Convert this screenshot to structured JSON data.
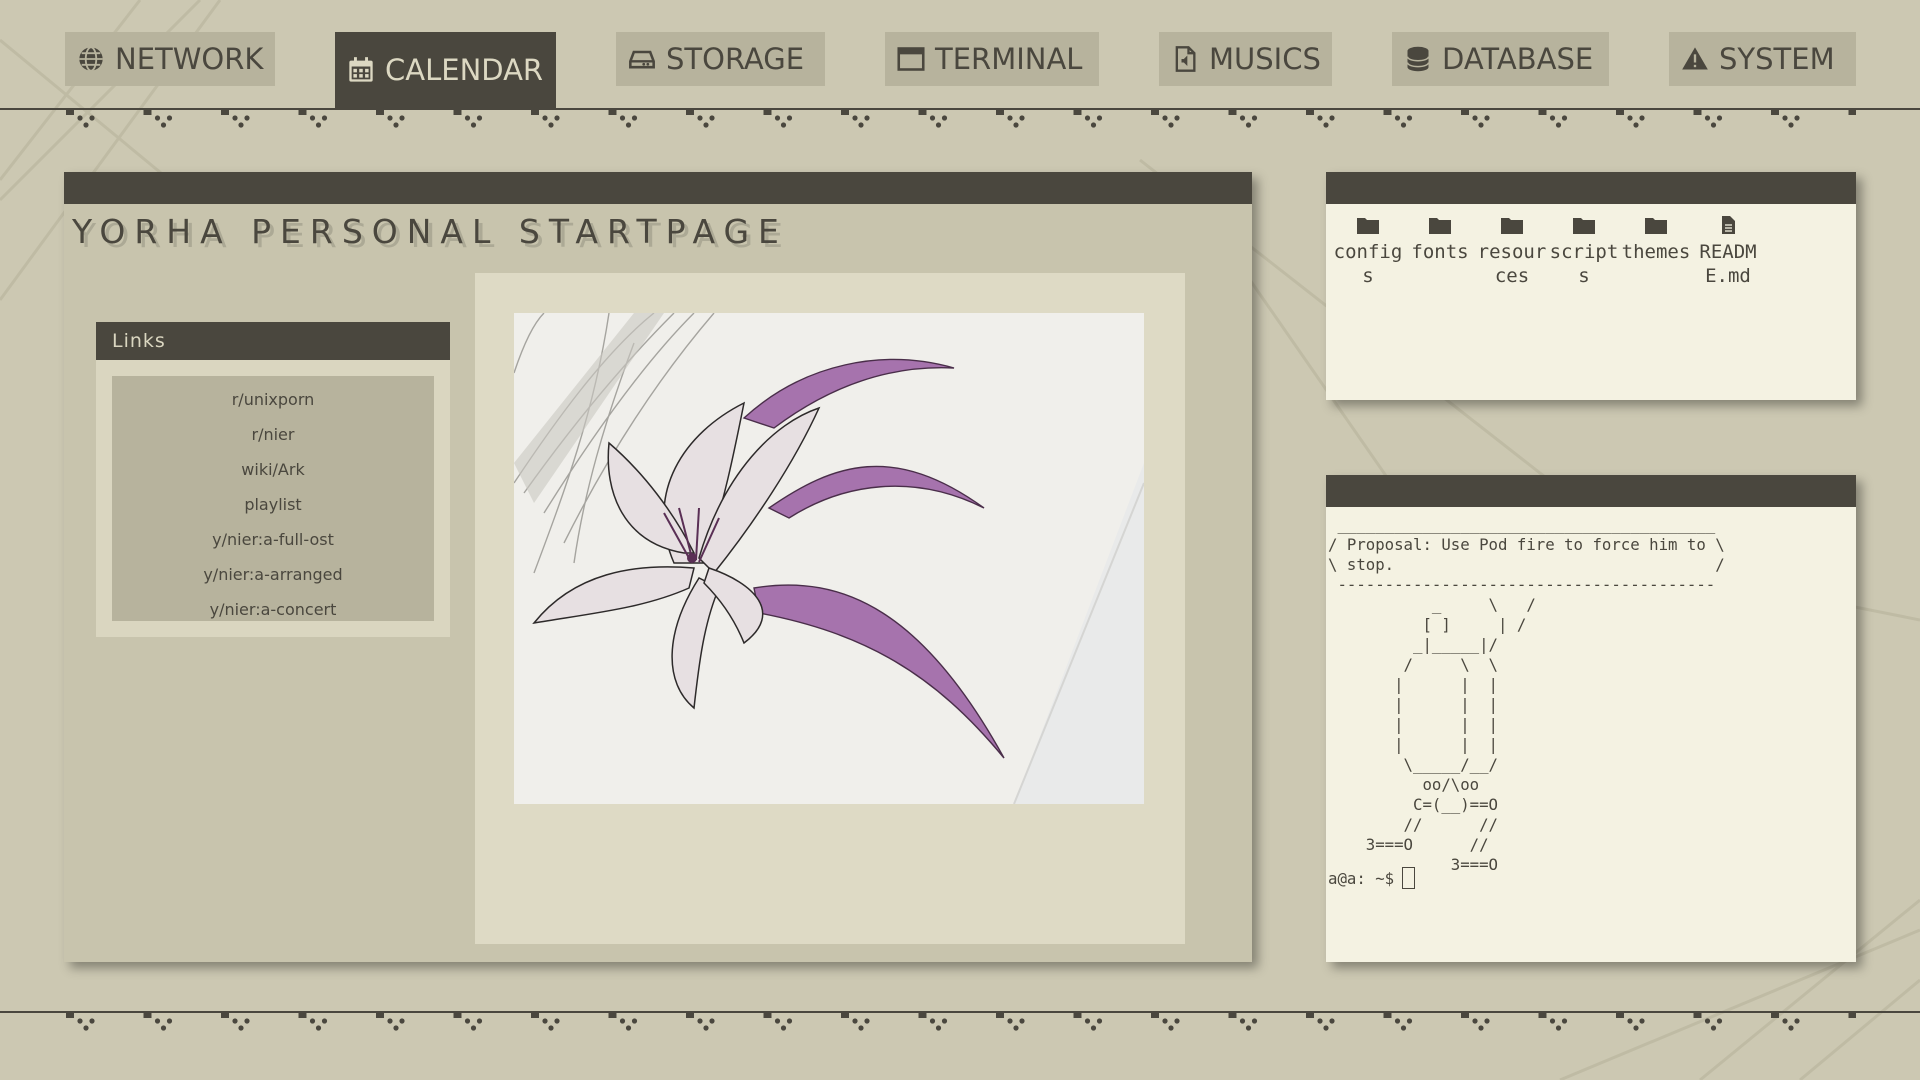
{
  "nav": {
    "items": [
      {
        "label": "NETWORK",
        "icon": "globe-icon",
        "active": false
      },
      {
        "label": "CALENDAR",
        "icon": "calendar-icon",
        "active": true
      },
      {
        "label": "STORAGE",
        "icon": "drive-icon",
        "active": false
      },
      {
        "label": "TERMINAL",
        "icon": "window-icon",
        "active": false
      },
      {
        "label": "MUSICS",
        "icon": "music-file-icon",
        "active": false
      },
      {
        "label": "DATABASE",
        "icon": "database-icon",
        "active": false
      },
      {
        "label": "SYSTEM",
        "icon": "warning-icon",
        "active": false
      }
    ]
  },
  "main": {
    "title": "YORHA PERSONAL STARTPAGE",
    "links_header": "Links",
    "links": [
      "r/unixporn",
      "r/nier",
      "wiki/Ark",
      "playlist",
      "y/nier:a-full-ost",
      "y/nier:a-arranged",
      "y/nier:a-concert"
    ]
  },
  "files": {
    "items": [
      {
        "name": "configs",
        "icon": "folder-icon"
      },
      {
        "name": "fonts",
        "icon": "folder-icon"
      },
      {
        "name": "resources",
        "icon": "folder-icon"
      },
      {
        "name": "scripts",
        "icon": "folder-icon"
      },
      {
        "name": "themes",
        "icon": "folder-icon"
      },
      {
        "name": "README.md",
        "icon": "file-icon"
      }
    ]
  },
  "terminal": {
    "output": " ________________________________________\n/ Proposal: Use Pod fire to force him to \\\n\\ stop.                                  /\n ----------------------------------------\n           _     \\   /\n          [ ]     | /\n         _|_____|/\n        /     \\  \\\n       |      |  |\n       |      |  |\n       |      |  |\n       |      |  |\n        \\_____/__/\n          oo/\\oo\n         C=(__)==O\n        //      //\n    3===O      //\n             3===O",
    "prompt": "a@a: ~$"
  },
  "colors": {
    "dark": "#4a473e",
    "background": "#ccc8b2",
    "panel": "#b7b39d",
    "light": "#f4f2e2",
    "flower": "#9e6aa8"
  }
}
